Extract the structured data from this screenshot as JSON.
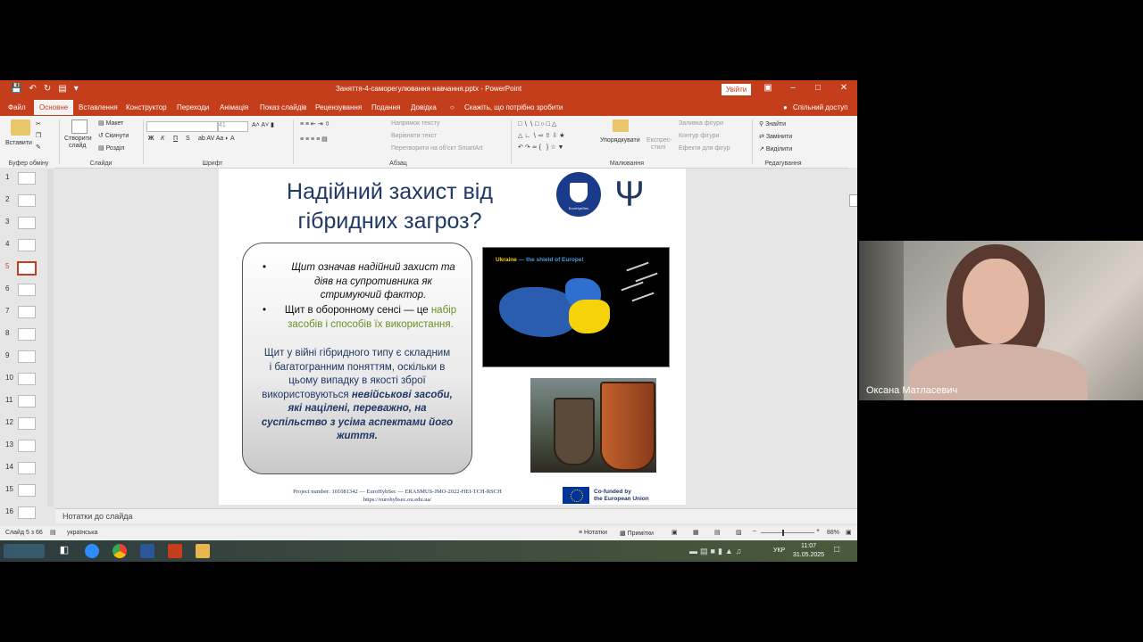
{
  "window": {
    "title": "Заняття-4-саморегулювання навчання.pptx  -  PowerPoint",
    "sign_in": "Увійти"
  },
  "menu": {
    "tabs": [
      "Файл",
      "Основне",
      "Вставлення",
      "Конструктор",
      "Переходи",
      "Анімація",
      "Показ слайдів",
      "Рецензування",
      "Подання",
      "Довідка"
    ],
    "tell_me": "Скажіть, що потрібно зробити",
    "share": "Спільний доступ"
  },
  "ribbon": {
    "clipboard": {
      "paste": "Вставити",
      "label": "Буфер обміну"
    },
    "slides": {
      "new_slide_1": "Створити",
      "new_slide_2": "слайд",
      "layout": "Макет",
      "reset": "Скинути",
      "section": "Розділ",
      "label": "Слайди"
    },
    "font": {
      "size": "41",
      "label": "Шрифт",
      "bold": "Ж",
      "italic": "К",
      "underline": "П",
      "strike": "S"
    },
    "paragraph": {
      "text_direction": "Напрямок тексту",
      "align_text": "Вирівняти текст",
      "smartart": "Перетворити на об'єкт SmartArt",
      "label": "Абзац"
    },
    "drawing": {
      "arrange": "Упорядкувати",
      "quick_styles_1": "Експрес-",
      "quick_styles_2": "стилі",
      "fill": "Заливка фігури",
      "outline": "Контур фігури",
      "effects": "Ефекти для фігур",
      "label": "Малювання"
    },
    "editing": {
      "find": "Знайти",
      "replace": "Замінити",
      "select": "Виділити",
      "label": "Редагування"
    }
  },
  "thumbnails": [
    "1",
    "2",
    "3",
    "4",
    "5",
    "6",
    "7",
    "8",
    "9",
    "10",
    "11",
    "12",
    "13",
    "14",
    "15",
    "16"
  ],
  "selected_slide": "5",
  "slide": {
    "title_line1": "Надійний захист від",
    "title_line2": "гібридних загроз?",
    "bullet1_line1": "Щит означав надійний захист та",
    "bullet1_line2": "діяв на супротивника як",
    "bullet1_line3": "стримуючий фактор.",
    "bullet2_a": "Щит в оборонному сенсі — це ",
    "bullet2_b": "набір",
    "bullet2_c": "засобів і способів їх використання.",
    "para_line1": "Щит у війні гібридного типу є складним",
    "para_line2": "і багатогранним поняттям, оскільки в",
    "para_line3": "цьому випадку в якості зброї",
    "para_line4a": "використовуються ",
    "para_line4b": "невійськові засоби,",
    "para_line5": "які націлені, переважно, на",
    "para_line6": "суспільство з усіма аспектами його",
    "para_line7": "життя.",
    "map_caption_a": "Ukraine",
    "map_caption_b": " — the shield of Europe!",
    "logo_text": "EuroHybSec",
    "footer_line1": "Project number: 101081342 — EuroHybSec — ERASMUS-JMO-2022-HEI-TCH-RSCH",
    "footer_line2": "https://eurohybsec.ou.edu.ua/",
    "eu_line1": "Co-funded by",
    "eu_line2": "the European Union"
  },
  "notes_placeholder": "Нотатки до слайда",
  "status": {
    "slide_info": "Слайд 5 з 66",
    "language": "українська",
    "notes": "Нотатки",
    "comments": "Примітки",
    "zoom": "88%"
  },
  "taskbar": {
    "lang": "УКР",
    "time": "11:07",
    "date": "31.05.2025"
  },
  "participant": {
    "name": "Оксана Матласевич"
  },
  "colors": {
    "accent": "#c43e1c",
    "title_text": "#1f3864",
    "highlight_green": "#6b8e23"
  }
}
